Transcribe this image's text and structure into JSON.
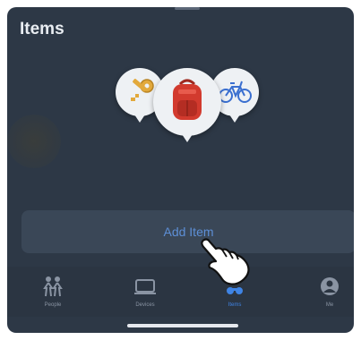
{
  "header": {
    "title": "Items"
  },
  "items_map": {
    "pins": [
      {
        "name": "key",
        "icon": "key-icon"
      },
      {
        "name": "backpack",
        "icon": "backpack-icon"
      },
      {
        "name": "bicycle",
        "icon": "bicycle-icon"
      }
    ]
  },
  "actions": {
    "add_item_label": "Add Item"
  },
  "tabs": [
    {
      "label": "People",
      "icon": "people-icon",
      "active": false
    },
    {
      "label": "Devices",
      "icon": "devices-icon",
      "active": false
    },
    {
      "label": "Items",
      "icon": "items-icon",
      "active": true
    },
    {
      "label": "Me",
      "icon": "person-icon",
      "active": false
    }
  ],
  "colors": {
    "background": "#2d3846",
    "accent": "#3f84e5",
    "button_bg": "#3a4757"
  }
}
